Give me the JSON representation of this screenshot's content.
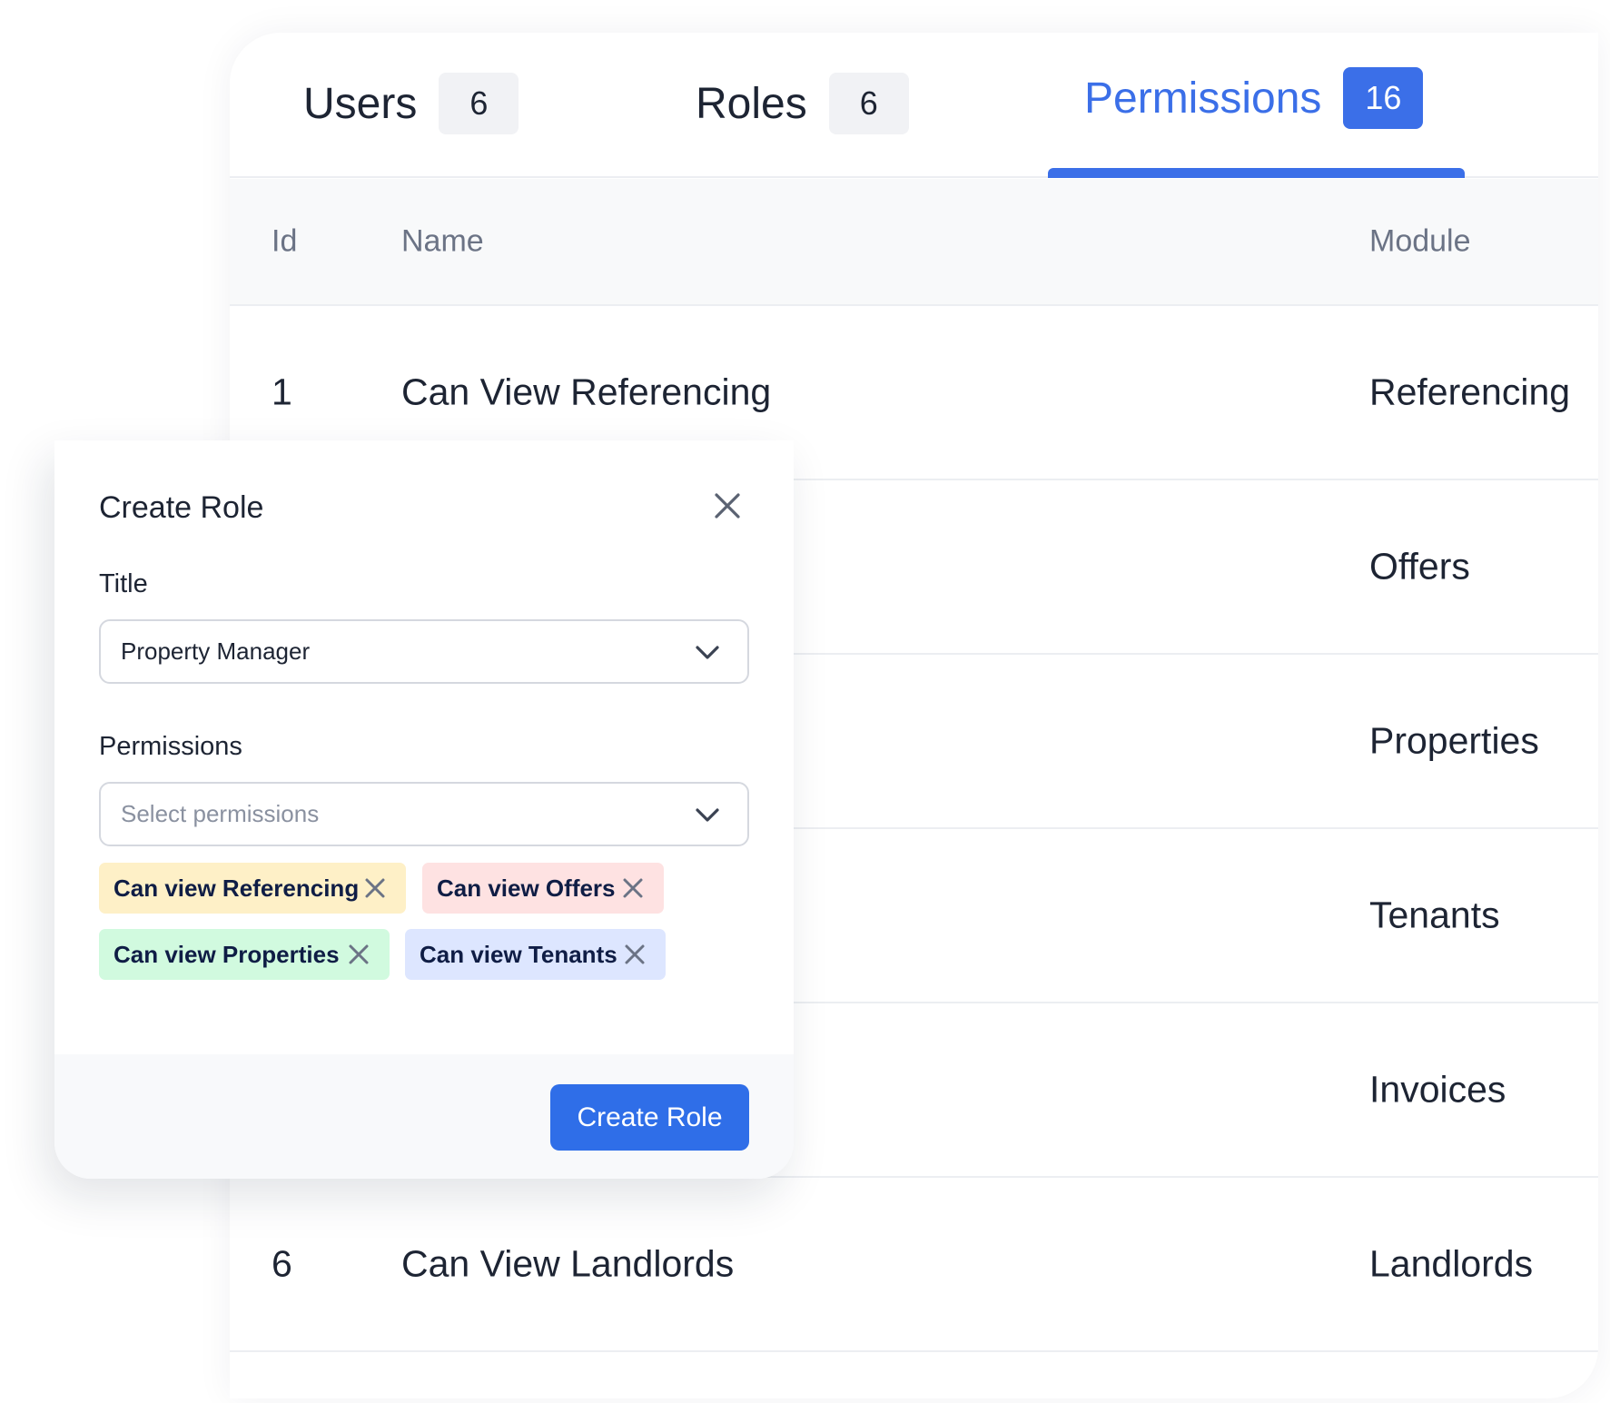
{
  "tabs": [
    {
      "label": "Users",
      "count": "6",
      "active": false
    },
    {
      "label": "Roles",
      "count": "6",
      "active": false
    },
    {
      "label": "Permissions",
      "count": "16",
      "active": true
    }
  ],
  "table": {
    "columns": [
      "Id",
      "Name",
      "Module"
    ],
    "rows": [
      {
        "id": "1",
        "name": "Can View Referencing",
        "module": "Referencing"
      },
      {
        "module": "Offers"
      },
      {
        "module": "Properties"
      },
      {
        "module": "Tenants"
      },
      {
        "module": "Invoices"
      },
      {
        "id": "6",
        "name": "Can View Landlords",
        "module": "Landlords"
      }
    ]
  },
  "modal": {
    "title": "Create Role",
    "title_label": "Title",
    "title_value": "Property Manager",
    "permissions_label": "Permissions",
    "permissions_placeholder": "Select permissions",
    "chips": [
      {
        "label": "Can view Referencing",
        "color": "#fef0c7"
      },
      {
        "label": "Can view Offers",
        "color": "#fee2e2"
      },
      {
        "label": "Can view Properties",
        "color": "#d1fadf"
      },
      {
        "label": "Can view Tenants",
        "color": "#dde6ff"
      }
    ],
    "submit_label": "Create Role"
  },
  "colors": {
    "accent": "#3b6fe8",
    "button": "#2f6ee8"
  }
}
